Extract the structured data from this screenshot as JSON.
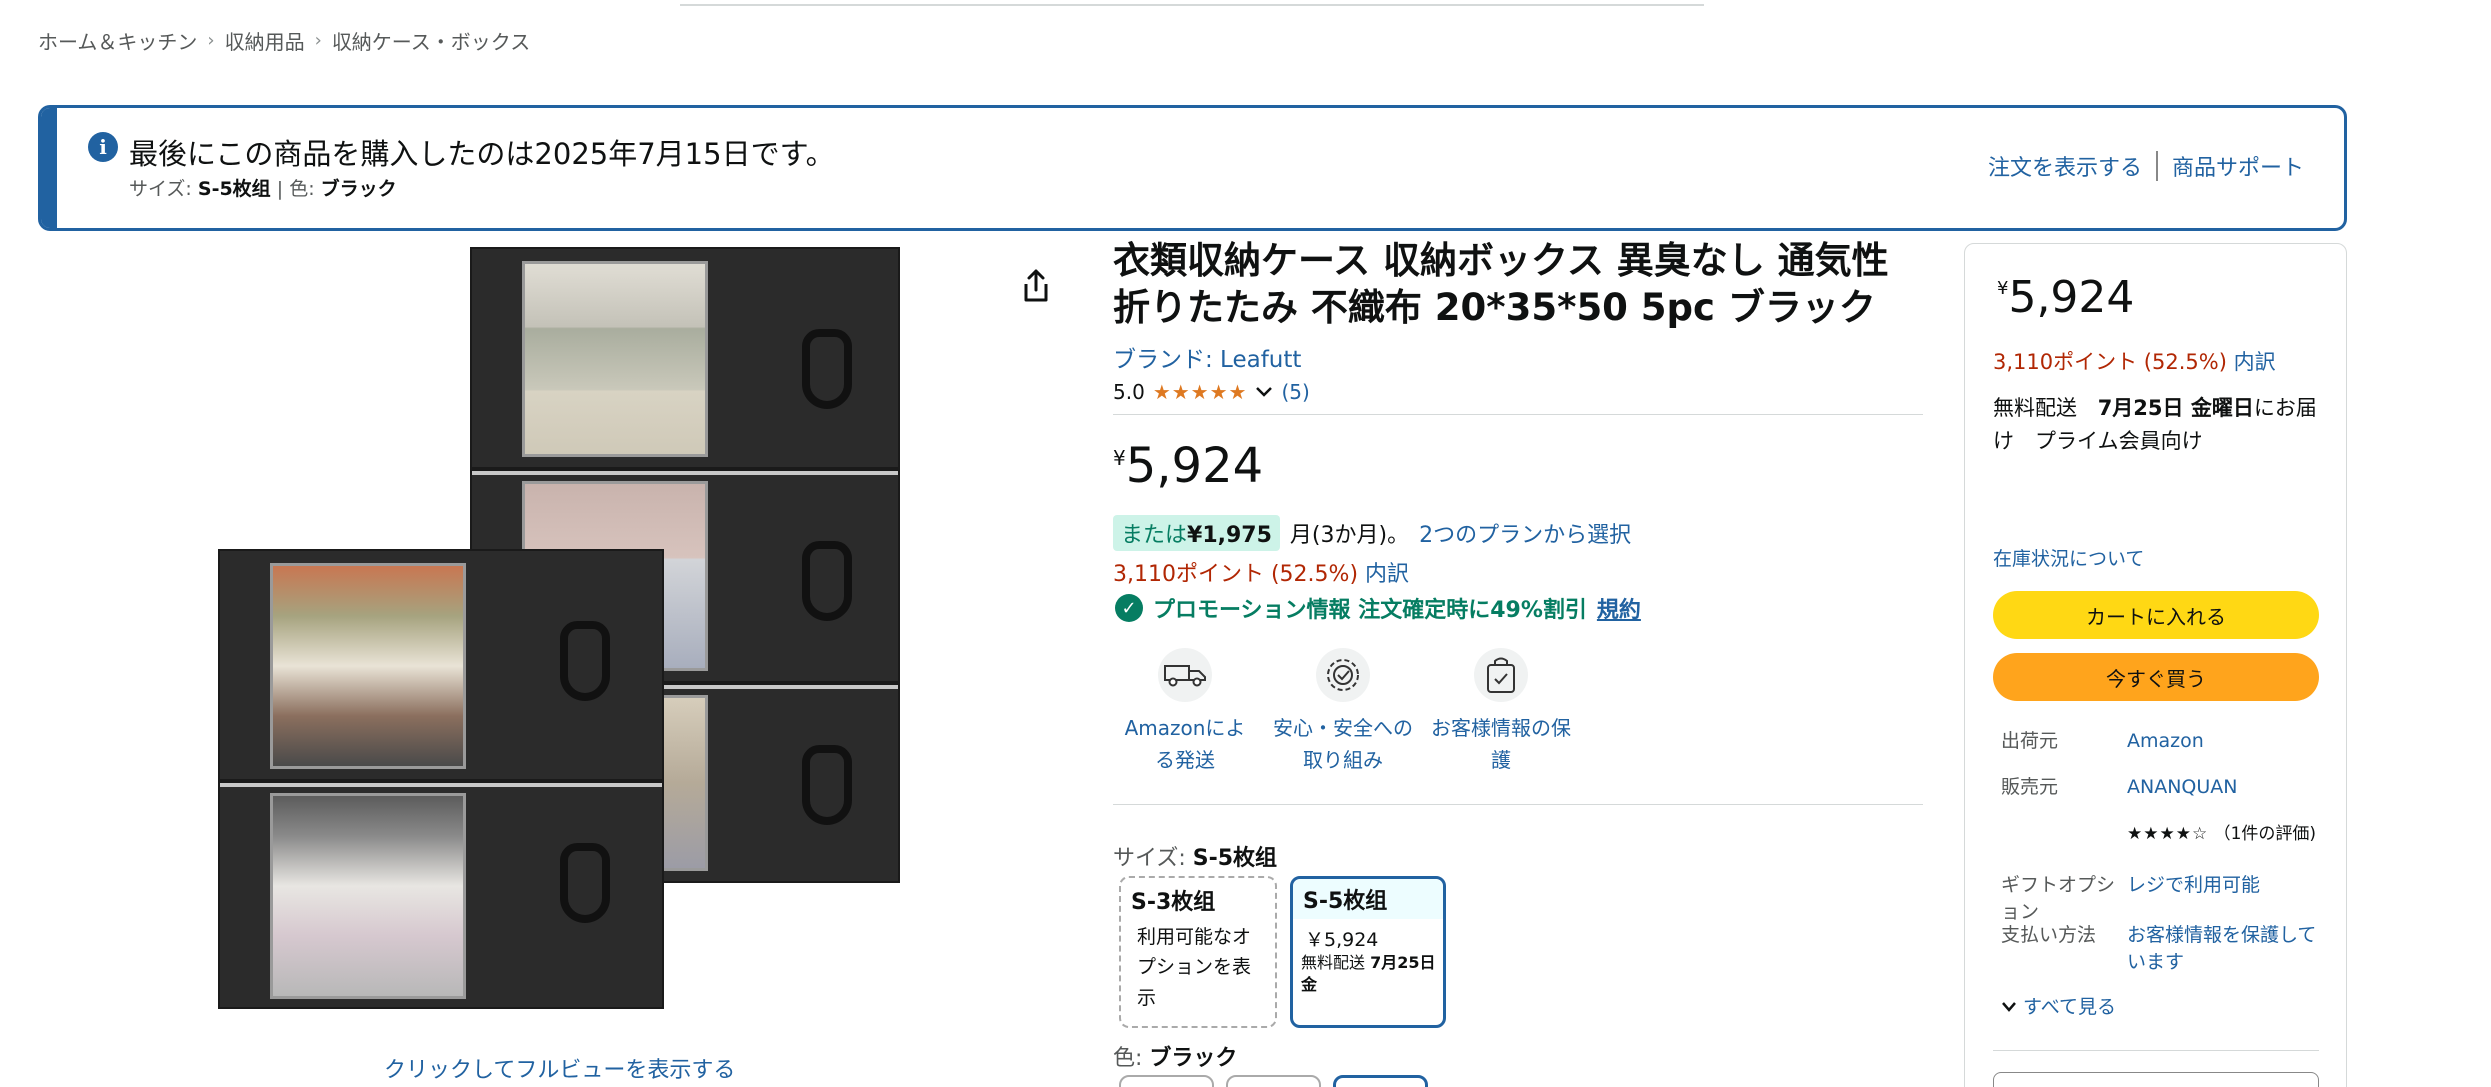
{
  "breadcrumb": [
    "ホーム＆キッチン",
    "収納用品",
    "収納ケース・ボックス"
  ],
  "breadcrumb_sep": "›",
  "notice": {
    "title": "最後にこの商品を購入したのは2025年7月15日です。",
    "size_label": "サイズ:",
    "size_value": "S-5枚组",
    "pipe": "|",
    "color_label": "色:",
    "color_value": "ブラック",
    "link_orders": "注文を表示する",
    "link_support": "商品サポート"
  },
  "gallery": {
    "full_view": "クリックしてフルビューを表示する"
  },
  "product": {
    "title": "衣類収納ケース 収納ボックス 異臭なし 通気性 折りたたみ 不織布 20*35*50 5pc ブラック",
    "brand": "ブランド: Leafutt",
    "rating": "5.0",
    "stars": "★★★★★",
    "rating_count": "(5)",
    "price_symbol": "¥",
    "price": "5,924",
    "installment_or": "または",
    "installment_amount": "¥1,975",
    "installment_term": "月(3か月)。",
    "installment_link": "2つのプランから選択",
    "points": "3,110ポイント (52.5%)",
    "points_detail": "内訳",
    "promo": "プロモーション情報 注文確定時に49%割引",
    "promo_terms": "規約",
    "features": [
      {
        "icon": "delivery-van-icon",
        "label": "Amazonによる発送"
      },
      {
        "icon": "safety-badge-icon",
        "label": "安心・安全への取り組み"
      },
      {
        "icon": "secure-bag-icon",
        "label": "お客様情報の保護"
      }
    ],
    "size_label": "サイズ:",
    "size_selected": "S-5枚组",
    "size_options": [
      {
        "name": "S-3枚组",
        "desc": "利用可能なオプションを表示"
      },
      {
        "name": "S-5枚组",
        "price": "￥5,924",
        "delivery_prefix": "無料配送",
        "delivery_date": "7月25日金"
      }
    ],
    "color_label": "色:",
    "color_selected": "ブラック"
  },
  "buybox": {
    "price_symbol": "¥",
    "price": "5,924",
    "points": "3,110ポイント (52.5%)",
    "points_detail": "内訳",
    "delivery_prefix": "無料配送",
    "delivery_date": "7月25日 金曜日",
    "delivery_suffix": "にお届け　プライム会員向け",
    "stock": "在庫状況について",
    "cart_button": "カートに入れる",
    "buy_button": "今すぐ買う",
    "shipper_label": "出荷元",
    "shipper": "Amazon",
    "seller_label": "販売元",
    "seller": "ANANQUAN",
    "seller_stars": "★★★★☆",
    "seller_reviews": "（1件の評価)",
    "gift_label": "ギフトオプション",
    "gift_value": "レジで利用可能",
    "payment_label": "支払い方法",
    "payment_value": "お客様情報を保護しています",
    "see_all": "すべて見る"
  },
  "colors": {
    "link": "#2162a1",
    "price_red": "#b12704",
    "promo_green": "#067d62",
    "cart_yellow": "#ffd814",
    "buy_orange": "#ffa41c"
  }
}
